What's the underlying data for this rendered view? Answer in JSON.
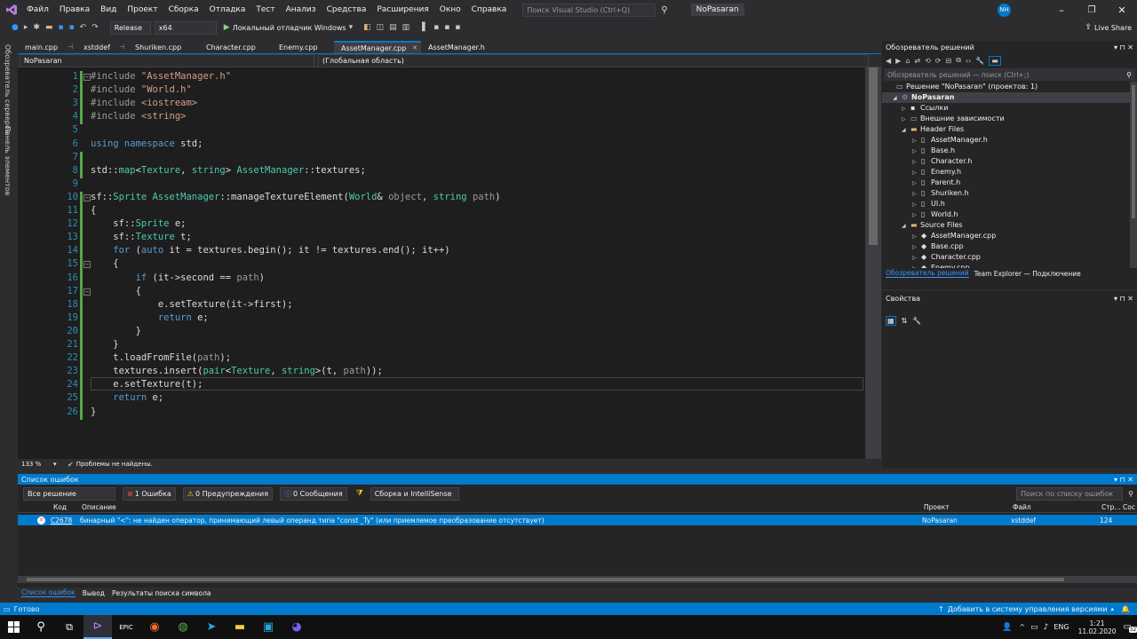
{
  "menu": [
    "Файл",
    "Правка",
    "Вид",
    "Проект",
    "Сборка",
    "Отладка",
    "Тест",
    "Анализ",
    "Средства",
    "Расширения",
    "Окно",
    "Справка"
  ],
  "search_placeholder": "Поиск Visual Studio (Ctrl+Q)",
  "project_name": "NoPasaran",
  "user_initials": "NH",
  "live_share": "Live Share",
  "toolbar": {
    "config": "Release",
    "platform": "x64",
    "debugger": "Локальный отладчик Windows"
  },
  "tabs": [
    "main.cpp",
    "xstddef",
    "Shuriken.cpp",
    "Character.cpp",
    "Enemy.cpp",
    "AssetManager.cpp",
    "AssetManager.h"
  ],
  "nav": {
    "project": "NoPasaran",
    "scope": "(Глобальная область)"
  },
  "code_lines": [
    [
      {
        "c": "pp",
        "t": "#include "
      },
      {
        "c": "st",
        "t": "\"AssetManager.h\""
      }
    ],
    [
      {
        "c": "pp",
        "t": "#include "
      },
      {
        "c": "st",
        "t": "\"World.h\""
      }
    ],
    [
      {
        "c": "pp",
        "t": "#include "
      },
      {
        "c": "st",
        "t": "<iostream>"
      }
    ],
    [
      {
        "c": "pp",
        "t": "#include "
      },
      {
        "c": "st",
        "t": "<string>"
      }
    ],
    [],
    [
      {
        "c": "kw",
        "t": "using namespace "
      },
      {
        "c": "id",
        "t": "std;"
      }
    ],
    [],
    [
      {
        "c": "id",
        "t": "std::"
      },
      {
        "c": "ty",
        "t": "map"
      },
      {
        "c": "id",
        "t": "<"
      },
      {
        "c": "ty",
        "t": "Texture"
      },
      {
        "c": "id",
        "t": ", "
      },
      {
        "c": "ty",
        "t": "string"
      },
      {
        "c": "id",
        "t": "> "
      },
      {
        "c": "ty",
        "t": "AssetManager"
      },
      {
        "c": "id",
        "t": "::textures;"
      }
    ],
    [],
    [
      {
        "c": "id",
        "t": "sf::"
      },
      {
        "c": "ty",
        "t": "Sprite AssetManager"
      },
      {
        "c": "id",
        "t": "::manageTextureElement("
      },
      {
        "c": "ty",
        "t": "World"
      },
      {
        "c": "id",
        "t": "& "
      },
      {
        "c": "pa",
        "t": "object"
      },
      {
        "c": "id",
        "t": ", "
      },
      {
        "c": "ty",
        "t": "string "
      },
      {
        "c": "pa",
        "t": "path"
      },
      {
        "c": "id",
        "t": ")"
      }
    ],
    [
      {
        "c": "id",
        "t": "{"
      }
    ],
    [
      {
        "c": "id",
        "t": "    sf::"
      },
      {
        "c": "ty",
        "t": "Sprite"
      },
      {
        "c": "id",
        "t": " e;"
      }
    ],
    [
      {
        "c": "id",
        "t": "    sf::"
      },
      {
        "c": "ty",
        "t": "Texture"
      },
      {
        "c": "id",
        "t": " t;"
      }
    ],
    [
      {
        "c": "kw",
        "t": "    for "
      },
      {
        "c": "id",
        "t": "("
      },
      {
        "c": "kw",
        "t": "auto"
      },
      {
        "c": "id",
        "t": " it = textures.begin(); it != textures.end(); it++)"
      }
    ],
    [
      {
        "c": "id",
        "t": "    {"
      }
    ],
    [
      {
        "c": "kw",
        "t": "        if "
      },
      {
        "c": "id",
        "t": "(it->second == "
      },
      {
        "c": "pa",
        "t": "path"
      },
      {
        "c": "id",
        "t": ")"
      }
    ],
    [
      {
        "c": "id",
        "t": "        {"
      }
    ],
    [
      {
        "c": "id",
        "t": "            e.setTexture(it->first);"
      }
    ],
    [
      {
        "c": "kw",
        "t": "            return "
      },
      {
        "c": "id",
        "t": "e;"
      }
    ],
    [
      {
        "c": "id",
        "t": "        }"
      }
    ],
    [
      {
        "c": "id",
        "t": "    }"
      }
    ],
    [
      {
        "c": "id",
        "t": "    t.loadFromFile("
      },
      {
        "c": "pa",
        "t": "path"
      },
      {
        "c": "id",
        "t": ");"
      }
    ],
    [
      {
        "c": "id",
        "t": "    textures.insert("
      },
      {
        "c": "ty",
        "t": "pair"
      },
      {
        "c": "id",
        "t": "<"
      },
      {
        "c": "ty",
        "t": "Texture"
      },
      {
        "c": "id",
        "t": ", "
      },
      {
        "c": "ty",
        "t": "string"
      },
      {
        "c": "id",
        "t": ">(t, "
      },
      {
        "c": "pa",
        "t": "path"
      },
      {
        "c": "id",
        "t": "));"
      }
    ],
    [
      {
        "c": "id",
        "t": "    e.setTexture(t);"
      }
    ],
    [
      {
        "c": "kw",
        "t": "    return "
      },
      {
        "c": "id",
        "t": "e;"
      }
    ],
    [
      {
        "c": "id",
        "t": "}"
      }
    ]
  ],
  "editor_status": {
    "zoom": "133 %",
    "issues": "Проблемы не найдены."
  },
  "solution": {
    "title": "Обозреватель решений",
    "search": "Обозреватель решений — поиск (Ctrl+;)",
    "root": "Решение \"NoPasaran\" (проектов: 1)",
    "project": "NoPasaran",
    "refs": "Ссылки",
    "deps": "Внешние зависимости",
    "headers": "Header Files",
    "header_files": [
      "AssetManager.h",
      "Base.h",
      "Character.h",
      "Enemy.h",
      "Parent.h",
      "Shuriken.h",
      "UI.h",
      "World.h"
    ],
    "sources": "Source Files",
    "source_files": [
      "AssetManager.cpp",
      "Base.cpp",
      "Character.cpp",
      "Enemy.cpp"
    ],
    "tab1": "Обозреватель решений",
    "tab2": "Team Explorer — Подключение"
  },
  "props_title": "Свойства",
  "errors": {
    "title": "Список ошибок",
    "scope": "Все решение",
    "errors_btn": "1 Ошибка",
    "warnings_btn": "0 Предупреждения",
    "messages_btn": "0 Сообщения",
    "build_filter": "Сборка и IntelliSense",
    "search": "Поиск по списку ошибок",
    "cols": {
      "code": "Код",
      "desc": "Описание",
      "project": "Проект",
      "file": "Файл",
      "line": "Стр...",
      "state": "Сос"
    },
    "row": {
      "code": "C2678",
      "desc": "бинарный \"<\": не найден оператор, принимающий левый операнд типа \"const _Ty\" (или приемлемое преобразование отсутствует)",
      "project": "NoPasaran",
      "file": "xstddef",
      "line": "124"
    },
    "bottom_tabs": [
      "Список ошибок",
      "Вывод",
      "Результаты поиска символа"
    ]
  },
  "side_panels": [
    "Обозреватель серверов",
    "Панель элементов"
  ],
  "status": {
    "ready": "Готово",
    "vcs": "Добавить в систему управления версиями"
  },
  "taskbar": {
    "lang": "ENG",
    "time": "1:21",
    "date": "11.02.2020",
    "badge": "32"
  }
}
